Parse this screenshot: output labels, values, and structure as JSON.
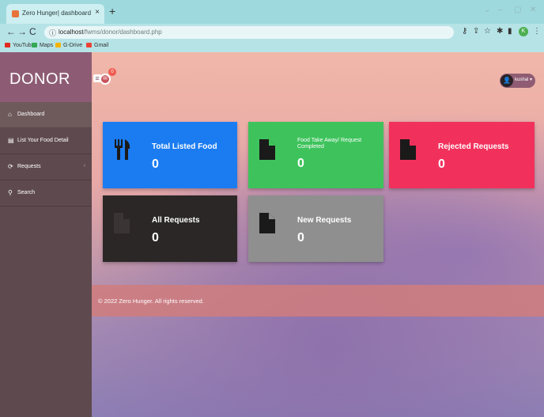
{
  "browser": {
    "tab_title": "Zero Hunger| dashboard",
    "tab_close": "×",
    "new_tab": "+",
    "url_host": "localhost",
    "url_path": "/fwms/donor/dashboard.php",
    "bookmarks": [
      {
        "label": "YouTube",
        "color": "#e02b20"
      },
      {
        "label": "Maps",
        "color": "#34a853"
      },
      {
        "label": "G-Drive",
        "color": "#f4b400"
      },
      {
        "label": "Gmail",
        "color": "#ea4335"
      }
    ]
  },
  "brand": "DONOR",
  "sidebar": {
    "items": [
      {
        "label": "Dashboard",
        "icon": "home-icon"
      },
      {
        "label": "List Your Food Detail",
        "icon": "list-icon"
      },
      {
        "label": "Requests",
        "icon": "requests-icon"
      },
      {
        "label": "Search",
        "icon": "search-icon"
      }
    ]
  },
  "topbar": {
    "messages_count": "0",
    "user_name": "kushal"
  },
  "cards": [
    {
      "title": "Total Listed Food",
      "value": "0",
      "color": "#1b7cf2",
      "icon": "utensils-icon"
    },
    {
      "title": "Food Take Away/ Request Completed",
      "value": "0",
      "color": "#3ec35c",
      "icon": "document-icon"
    },
    {
      "title": "Rejected Requests",
      "value": "0",
      "color": "#f2305c",
      "icon": "document-icon"
    },
    {
      "title": "All Requests",
      "value": "0",
      "color": "#2c2727",
      "icon": "document-icon"
    },
    {
      "title": "New Requests",
      "value": "0",
      "color": "#8f8f8f",
      "icon": "document-icon"
    }
  ],
  "footer": {
    "text": "© 2022 Zero Hunger. All rights reserved."
  }
}
